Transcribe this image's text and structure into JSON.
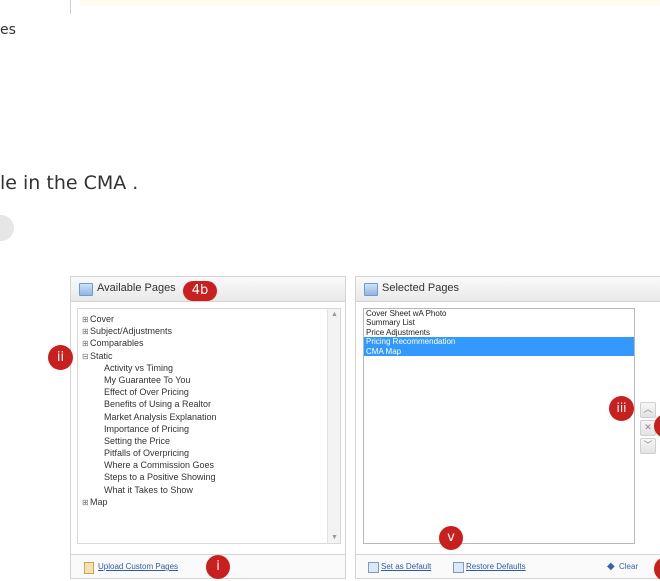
{
  "doc": {
    "truncated_top": "es",
    "instruction_text": "le in the CMA ."
  },
  "available": {
    "title": "Available Pages",
    "badge": "4b",
    "tree": [
      {
        "label": "Cover",
        "expander": "+",
        "level": 0
      },
      {
        "label": "Subject/Adjustments",
        "expander": "+",
        "level": 0
      },
      {
        "label": "Comparables",
        "expander": "+",
        "level": 0
      },
      {
        "label": "Static",
        "expander": "−",
        "level": 0
      },
      {
        "label": "Activity vs Timing",
        "level": 1
      },
      {
        "label": "My Guarantee To You",
        "level": 1
      },
      {
        "label": "Effect of Over Pricing",
        "level": 1
      },
      {
        "label": "Benefits of Using a Realtor",
        "level": 1
      },
      {
        "label": "Market Analysis Explanation",
        "level": 1
      },
      {
        "label": "Importance of Pricing",
        "level": 1
      },
      {
        "label": "Setting the Price",
        "level": 1
      },
      {
        "label": "Pitfalls of Overpricing",
        "level": 1
      },
      {
        "label": "Where a Commission Goes",
        "level": 1
      },
      {
        "label": "Steps to a Positive Showing",
        "level": 1
      },
      {
        "label": "What it Takes to Show",
        "level": 1
      },
      {
        "label": "Map",
        "expander": "+",
        "level": 0
      }
    ],
    "upload_label": "Upload Custom Pages",
    "badge_i": "i",
    "badge_ii": "ii"
  },
  "selected": {
    "title": "Selected Pages",
    "items": [
      {
        "label": "Cover Sheet wA Photo",
        "selected": false
      },
      {
        "label": "Summary List",
        "selected": false
      },
      {
        "label": "Price Adjustments",
        "selected": false
      },
      {
        "label": "Pricing Recommendation",
        "selected": true
      },
      {
        "label": "CMA Map",
        "selected": true
      }
    ],
    "set_default_label": "Set as Default",
    "restore_defaults_label": "Restore Defaults",
    "clear_label": "Clear",
    "badge_iii": "iii",
    "badge_v": "v",
    "up_icon": "chevron-up-icon",
    "remove_icon": "close-icon",
    "down_icon": "chevron-down-icon"
  },
  "colors": {
    "badge": "#c8201e",
    "selection": "#3399ff",
    "link": "#2a5db0"
  }
}
